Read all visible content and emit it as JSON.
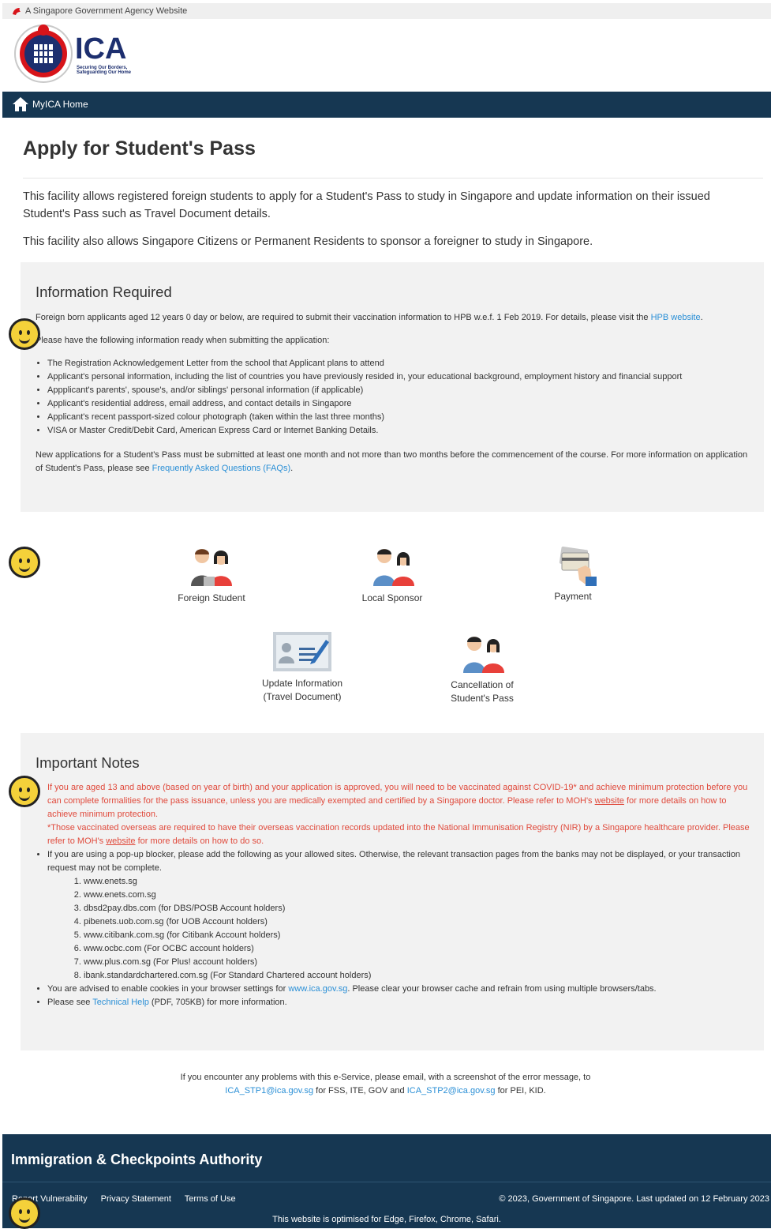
{
  "masthead": {
    "text": "A Singapore Government Agency Website"
  },
  "logo": {
    "text": "ICA",
    "tagline_1": "Securing Our Borders,",
    "tagline_2": "Safeguarding Our Home"
  },
  "nav": {
    "home_label": "MyICA Home"
  },
  "page": {
    "title": "Apply for Student's Pass",
    "intro_1": "This facility allows registered foreign students to apply for a Student's Pass to study in Singapore and update information on their issued Student's Pass such as Travel Document details.",
    "intro_2": "This facility also allows Singapore Citizens or Permanent Residents to sponsor a foreigner to study in Singapore."
  },
  "info": {
    "heading": "Information Required",
    "vaccination_text": "Foreign born applicants aged 12 years 0 day or below, are required to submit their vaccination information to HPB w.e.f. 1 Feb 2019. For details, please visit the ",
    "hpb_link": "HPB website",
    "ready_text": "Please have the following information ready when submitting the application:",
    "items": [
      "The Registration Acknowledgement Letter from the school that Applicant plans to attend",
      "Applicant's personal information, including the list of countries you have previously resided in, your educational background, employment history and financial support",
      "Appplicant's parents', spouse's, and/or siblings' personal information (if applicable)",
      "Applicant's residential address, email address, and contact details in Singapore",
      "Applicant's recent passport-sized colour photograph (taken within the last three months)",
      "VISA or Master Credit/Debit Card, American Express Card or Internet Banking Details."
    ],
    "new_app_text": "New applications for a Student's Pass must be submitted at least one month and not more than two months before the commencement of the course. For more information on application of Student's Pass, please see ",
    "faq_link": "Frequently Asked Questions (FAQs)"
  },
  "tiles": {
    "foreign_student": "Foreign Student",
    "local_sponsor": "Local Sponsor",
    "payment": "Payment",
    "update_1": "Update Information",
    "update_2": "(Travel Document)",
    "cancel_1": "Cancellation of",
    "cancel_2": "Student's Pass"
  },
  "notes": {
    "heading": "Important Notes",
    "covid_a": "If you are aged 13 and above (based on year of birth) and your application is approved, you will need to be vaccinated against COVID-19* and achieve minimum protection before you can complete formalities for the pass issuance, unless you are medically exempted and certified by a Singapore doctor. Please refer to MOH's ",
    "covid_link": "website",
    "covid_b": " for more details on how to achieve minimum protection.",
    "overseas_a": "*Those vaccinated overseas are required to have their overseas vaccination records updated into the National Immunisation Registry (NIR) by a Singapore healthcare provider. Please refer to MOH's ",
    "overseas_link": "website",
    "overseas_b": " for more details on how to do so.",
    "popup_text": "If you are using a pop-up blocker, please add the following as your allowed sites. Otherwise, the relevant transaction pages from the banks may not be displayed, or your transaction request may not be complete.",
    "sites": [
      "www.enets.sg",
      "www.enets.com.sg",
      "dbsd2pay.dbs.com (for DBS/POSB Account holders)",
      "pibenets.uob.com.sg (for UOB Account holders)",
      "www.citibank.com.sg (for Citibank Account holders)",
      "www.ocbc.com (For OCBC account holders)",
      "www.plus.com.sg (For Plus! account holders)",
      "ibank.standardchartered.com.sg (For Standard Chartered account holders)"
    ],
    "cookies_a": "You are advised to enable cookies in your browser settings for ",
    "cookies_link": "www.ica.gov.sg",
    "cookies_b": ". Please clear your browser cache and refrain from using multiple browsers/tabs.",
    "help_a": "Please see ",
    "help_link": "Technical Help",
    "help_b": " (PDF, 705KB) for more information."
  },
  "contact": {
    "line1": "If you encounter any problems with this e-Service, please email, with a screenshot of the error message, to",
    "email1": "ICA_STP1@ica.gov.sg",
    "mid": " for FSS, ITE, GOV and ",
    "email2": "ICA_STP2@ica.gov.sg",
    "end": " for PEI, KID."
  },
  "footer": {
    "title": "Immigration & Checkpoints Authority",
    "links": [
      "Report Vulnerability",
      "Privacy Statement",
      "Terms of Use"
    ],
    "copyright": "© 2023, Government of Singapore. Last updated on 12 February 2023",
    "optimised": "This website is optimised for Edge, Firefox, Chrome, Safari."
  },
  "colors": {
    "navy": "#163752",
    "link": "#2a8fd6",
    "alert": "#e04a3c",
    "panel": "#f2f2f2"
  }
}
